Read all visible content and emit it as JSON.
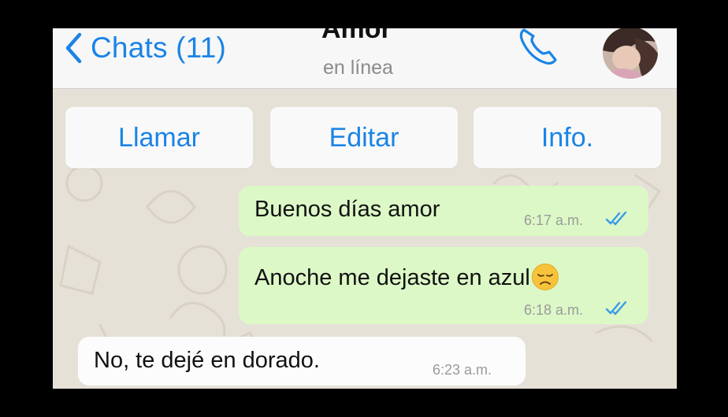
{
  "header": {
    "back_label": "Chats (11)",
    "contact_name": "Amor",
    "status": "en línea"
  },
  "actions": {
    "call": "Llamar",
    "edit": "Editar",
    "info": "Info."
  },
  "messages": [
    {
      "direction": "outgoing",
      "text": "Buenos días amor",
      "time": "6:17 a.m.",
      "read": true
    },
    {
      "direction": "outgoing",
      "text": "Anoche me dejaste en azul",
      "emoji": "disappointed-face",
      "time": "6:18 a.m.",
      "read": true
    },
    {
      "direction": "incoming",
      "text": "No, te dejé en dorado.",
      "time": "6:23 a.m."
    }
  ],
  "colors": {
    "accent": "#1a84e6",
    "outgoing_bubble": "#dcf8c6",
    "incoming_bubble": "#fcfcfc",
    "wallpaper": "#e6e1d7",
    "read_ticks": "#3a9be8"
  }
}
